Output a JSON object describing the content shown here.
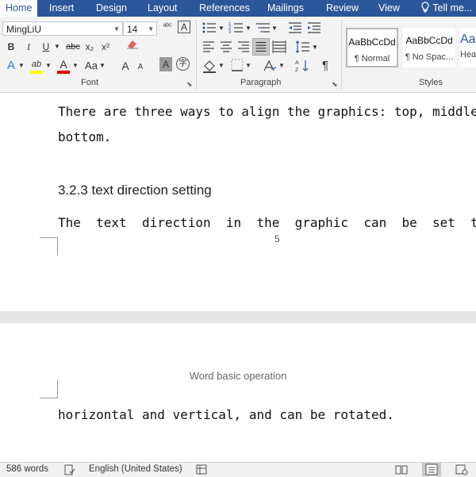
{
  "ribbon_tabs": [
    {
      "label": "Home",
      "active": true
    },
    {
      "label": "Insert"
    },
    {
      "label": "Design"
    },
    {
      "label": "Layout"
    },
    {
      "label": "References"
    },
    {
      "label": "Mailings"
    },
    {
      "label": "Review"
    },
    {
      "label": "View"
    }
  ],
  "tell_me": "Tell me...",
  "font_group": {
    "font_name": "MingLiU",
    "font_size": "14",
    "label": "Font",
    "buttons": {
      "bold": "B",
      "italic": "I",
      "underline": "U",
      "strikethrough": "abc",
      "subscript": "x₂",
      "superscript": "x²",
      "change_case": "Aa",
      "grow_font": "A",
      "shrink_font": "A",
      "clear_formatting": "A",
      "text_effects": "A",
      "highlight": "ab",
      "font_color": "A",
      "char_shading": "A",
      "enclose": "字"
    }
  },
  "paragraph_group": {
    "label": "Paragraph",
    "show_marks": "¶"
  },
  "styles_group": {
    "label": "Styles",
    "items": [
      {
        "sample": "AaBbCcDd",
        "name": "¶ Normal"
      },
      {
        "sample": "AaBbCcDd",
        "name": "¶ No Spac..."
      },
      {
        "sample": "AaBl",
        "name": "Hea"
      }
    ]
  },
  "document": {
    "line1": "There are three ways to align the graphics: top, middle,",
    "line2": "bottom.",
    "heading": "3.2.3 text direction setting",
    "line3": "The  text  direction  in  the  graphic  can  be  set  to  be",
    "page_number": "5",
    "header_text": "Word basic operation",
    "line4": "horizontal and vertical, and can be rotated."
  },
  "status_bar": {
    "word_count": "586 words",
    "language": "English (United States)"
  }
}
